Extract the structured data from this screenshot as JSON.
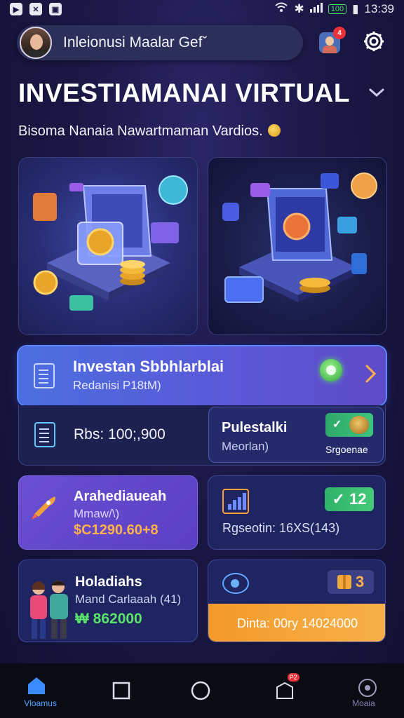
{
  "status_bar": {
    "time": "13:39",
    "battery": "100"
  },
  "header": {
    "profile_name": "Inleionusi Maalar Gefˇ",
    "notification_count": "4"
  },
  "title": "INVESTIAMANAI VIRTUAL",
  "subtitle": "Bisoma Nanaia Nawartmaman Vardios.",
  "invest_banner": {
    "title": "Investan Sbbhlarblai",
    "subtitle": "Redanisi P18tM)"
  },
  "balance": {
    "text": "Rbs: 100;,900"
  },
  "pulse_card": {
    "title": "Pulestalki",
    "subtitle": "Meorlan)",
    "label": "Srgoenae"
  },
  "card_1": {
    "title": "Arahediaueah",
    "subtitle": "Mmaw/\\)",
    "value": "$C1290.60+8"
  },
  "card_2": {
    "badge": "12",
    "text": "Rgseotin: 16XS(143)"
  },
  "card_3": {
    "title": "Holadiahs",
    "subtitle": "Mand Carlaaah (41)",
    "value": "₩ 862000"
  },
  "card_4": {
    "badge": "3",
    "button": "Dinta: 00ry 14024000"
  },
  "nav": {
    "items": [
      {
        "label": "Vloamus",
        "icon": "home-icon",
        "active": true
      },
      {
        "label": "",
        "icon": "square-icon"
      },
      {
        "label": "",
        "icon": "circle-icon"
      },
      {
        "label": "",
        "icon": "inbox-icon",
        "badge": "P2"
      },
      {
        "label": "Moaia",
        "icon": "profile-icon"
      }
    ]
  }
}
